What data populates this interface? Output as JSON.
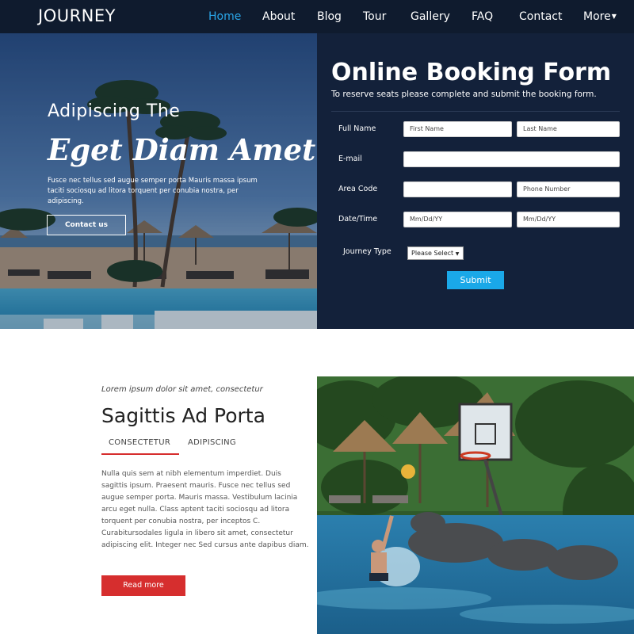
{
  "nav": {
    "brand": "JOURNEY",
    "items": [
      "Home",
      "About",
      "Blog",
      "Tour",
      "Gallery",
      "FAQ",
      "Contact",
      "More"
    ],
    "active": "Home"
  },
  "hero": {
    "kicker": "Adipiscing The",
    "title": "Eget Diam Amet",
    "text": "Fusce nec tellus sed augue semper porta Mauris massa ipsum taciti sociosqu ad litora torquent per conubia nostra, per adipiscing.",
    "button": "Contact us"
  },
  "form": {
    "title": "Online Booking Form",
    "subtitle": "To reserve seats please complete and submit the booking form.",
    "labels": {
      "full_name": "Full Name",
      "email": "E-mail",
      "area_code": "Area Code",
      "date_time": "Date/Time",
      "journey_type": "Journey Type"
    },
    "placeholders": {
      "first_name": "First Name",
      "last_name": "Last Name",
      "email": "",
      "area_code": "",
      "phone": "Phone Number",
      "date1": "Mm/Dd/YY",
      "date2": "Mm/Dd/YY"
    },
    "select_value": "Please Select",
    "submit": "Submit"
  },
  "about": {
    "kicker": "Lorem ipsum dolor sit amet, consectetur",
    "title": "Sagittis Ad Porta",
    "tabs": [
      "CONSECTETUR",
      "ADIPISCING"
    ],
    "active_tab": "CONSECTETUR",
    "text": "Nulla quis sem at nibh elementum imperdiet. Duis sagittis ipsum. Praesent mauris. Fusce nec tellus sed augue semper porta. Mauris massa. Vestibulum lacinia arcu eget nulla. Class aptent taciti sociosqu ad litora torquent per conubia nostra, per inceptos C. Curabitursodales ligula in libero sit amet, consectetur adipiscing elit. Integer nec Sed cursus ante dapibus diam.",
    "button": "Read more"
  },
  "colors": {
    "nav_bg": "#0f1b2e",
    "accent_blue": "#1aa8e8",
    "accent_red": "#d62e2e",
    "form_bg": "#13213a"
  }
}
